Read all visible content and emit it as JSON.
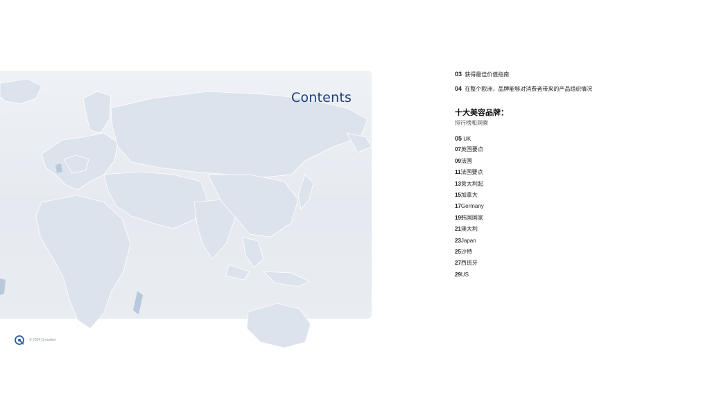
{
  "title": "Contents",
  "toc": {
    "intro_lines": [
      {
        "num": "03",
        "text": "获得最佳价值指南"
      },
      {
        "num": "04",
        "text": "在整个欧洲，品牌能够对消费者带来的产品组织情况"
      }
    ],
    "brands_heading": "十大美容品牌：",
    "brands_sub": "排行榜和洞察",
    "items": [
      {
        "num": "05",
        "text": " UK"
      },
      {
        "num": "07",
        "text": "英国要点"
      },
      {
        "num": "09",
        "text": "法国"
      },
      {
        "num": "11",
        "text": "法国要点"
      },
      {
        "num": "13",
        "text": "意大利起"
      },
      {
        "num": "15",
        "text": "加拿大"
      },
      {
        "num": "17",
        "text": "Germany"
      },
      {
        "num": "19",
        "text": "韩国国家"
      },
      {
        "num": "21",
        "text": "澳大利"
      },
      {
        "num": "23",
        "text": "Japan"
      },
      {
        "num": "25",
        "text": "沙特"
      },
      {
        "num": "27",
        "text": "西班牙"
      },
      {
        "num": "29",
        "text": "US"
      }
    ]
  },
  "footer": {
    "logo_icon": "q-logo-icon",
    "text": "© 2024 Q-market"
  },
  "colors": {
    "title": "#1f3f78",
    "map_land": "#dfe5ee",
    "map_panel": "#e9ecf1",
    "map_water_accent": "#b9c9dc"
  }
}
